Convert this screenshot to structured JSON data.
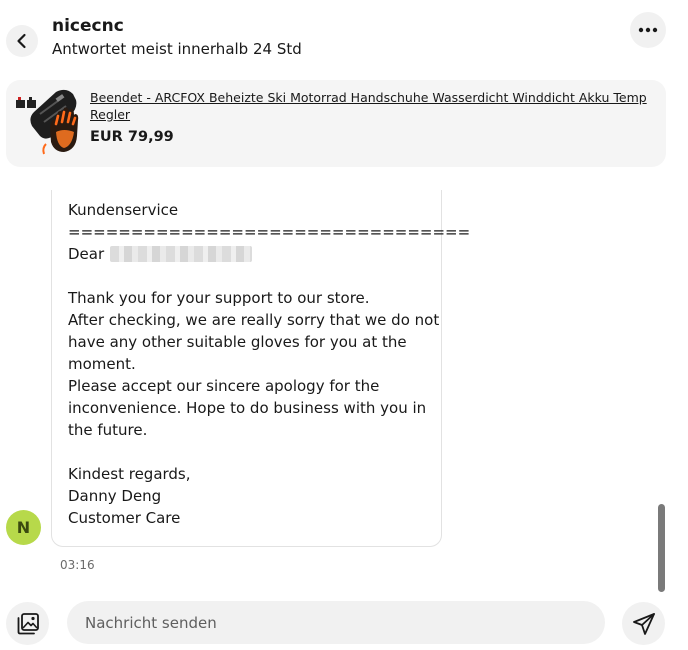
{
  "header": {
    "seller_name": "nicecnc",
    "response_info": "Antwortet meist innerhalb 24 Std",
    "back_icon": "chevron-left-icon",
    "more_icon": "more-dots-icon"
  },
  "product": {
    "title": "Beendet - ARCFOX Beheizte Ski Motorrad Handschuhe Wasserdicht Winddicht Akku Temp Regler",
    "price": "EUR 79,99",
    "thumbnail_icon": "heated-glove-icon"
  },
  "message": {
    "lines": {
      "l1": "Kundenservice",
      "l2": "================================",
      "l3": "Dear",
      "l4": "Thank you for your support to our store.",
      "l5": "After checking, we are really sorry that we do not",
      "l6": "have any other suitable gloves for you at the",
      "l7": "moment.",
      "l8": "Please accept our sincere apology for the",
      "l9": "inconvenience. Hope to do business with you in",
      "l10": "the future.",
      "l11": "Kindest regards,",
      "l12": "Danny Deng",
      "l13": "Customer Care"
    },
    "avatar_initial": "N",
    "time": "03:16"
  },
  "composer": {
    "placeholder": "Nachricht senden",
    "gallery_icon": "gallery-icon",
    "send_icon": "send-icon"
  },
  "colors": {
    "avatar_bg": "#b7d94a",
    "surface": "#f1f1f1",
    "text": "#191919"
  }
}
